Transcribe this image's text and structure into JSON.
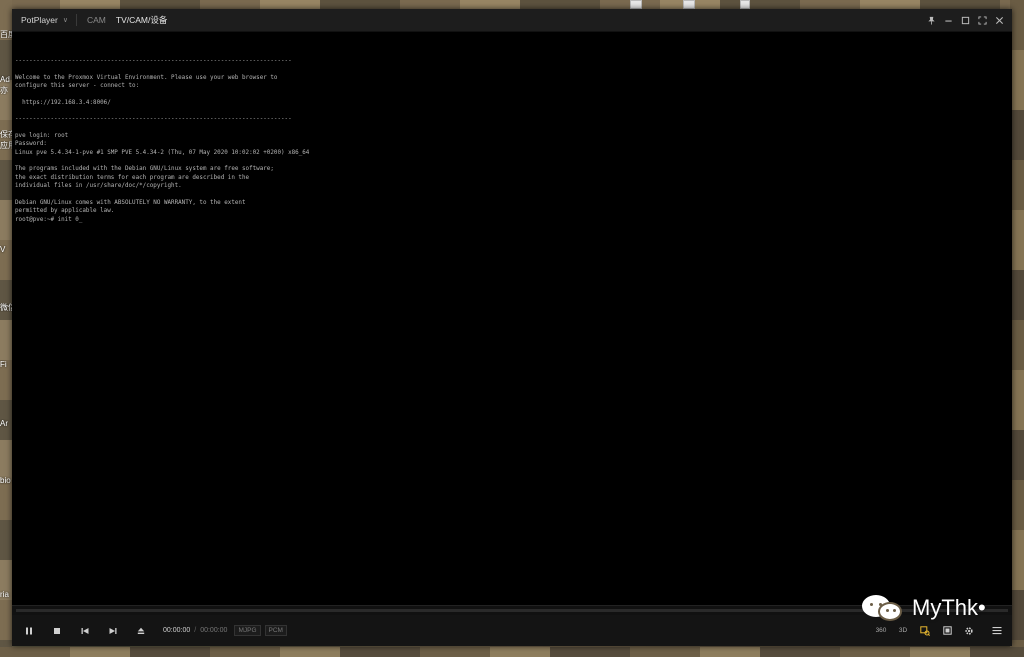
{
  "window": {
    "app_name": "PotPlayer",
    "tabs": [
      {
        "label": "CAM"
      },
      {
        "label": "TV/CAM/设备"
      }
    ],
    "controls": {
      "pin": "pin-icon",
      "minimize": "minimize-icon",
      "maximize": "maximize-icon",
      "fullscreen": "fullscreen-icon",
      "close": "close-icon"
    }
  },
  "terminal": {
    "lines": [
      "------------------------------------------------------------------------------",
      "",
      "Welcome to the Proxmox Virtual Environment. Please use your web browser to",
      "configure this server - connect to:",
      "",
      "  https://192.168.3.4:8006/",
      "",
      "------------------------------------------------------------------------------",
      "",
      "pve login: root",
      "Password:",
      "Linux pve 5.4.34-1-pve #1 SMP PVE 5.4.34-2 (Thu, 07 May 2020 10:02:02 +0200) x86_64",
      "",
      "The programs included with the Debian GNU/Linux system are free software;",
      "the exact distribution terms for each program are described in the",
      "individual files in /usr/share/doc/*/copyright.",
      "",
      "Debian GNU/Linux comes with ABSOLUTELY NO WARRANTY, to the extent",
      "permitted by applicable law.",
      "root@pve:~# init 0_"
    ]
  },
  "playback": {
    "progress_fraction": 0,
    "current_time": "00:00:00",
    "separator": "/",
    "duration": "00:00:00",
    "video_codec": "MJPG",
    "audio_codec": "PCM",
    "btn_360": "360",
    "btn_3d": "3D"
  },
  "watermark": {
    "text": "MyThk•"
  },
  "desktop": {
    "left_labels": [
      "百度",
      "Ad",
      "亦",
      "保存",
      "应用",
      "V",
      "微信",
      "Fi",
      "Ar",
      "bio",
      "ria"
    ]
  }
}
